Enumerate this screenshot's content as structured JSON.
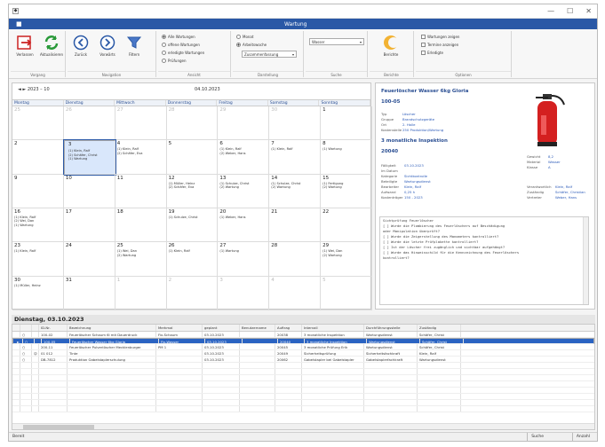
{
  "window": {
    "title": "Wartung",
    "file_tab": "■"
  },
  "ribbon": {
    "groups": [
      {
        "label": "Vorgang"
      },
      {
        "label": "Navigation"
      },
      {
        "label": "Ansicht"
      },
      {
        "label": "Darstellung"
      },
      {
        "label": "Suche"
      },
      {
        "label": "Berichte"
      },
      {
        "label": "Optionen"
      }
    ],
    "buttons": {
      "exit": "Verlassen",
      "refresh": "Aktualisieren",
      "back": "Zurück",
      "forward": "Vorwärts",
      "filter": "Filtern",
      "report": "Berichte"
    },
    "view_options": [
      "Alle Wartungen",
      "offene Wartungen",
      "erledigte Wartungen",
      "Prüfungen"
    ],
    "display_options": [
      "Monat",
      "Arbeitswoche"
    ],
    "display_select": "Zusammenfassung",
    "search_value": "Wasser",
    "option_checks": [
      "Wartungen zeigen",
      "Termine anzeigen",
      "Erledigte"
    ]
  },
  "calendar": {
    "nav": "◄ ► 2023 – 10",
    "current_date": "04.10.2023",
    "days": [
      "Montag",
      "Dienstag",
      "Mittwoch",
      "Donnerstag",
      "Freitag",
      "Samstag",
      "Sonntag"
    ],
    "weeks": [
      [
        {
          "d": "25",
          "out": true
        },
        {
          "d": "26",
          "out": true
        },
        {
          "d": "27",
          "out": true
        },
        {
          "d": "28",
          "out": true
        },
        {
          "d": "29",
          "out": true
        },
        {
          "d": "30",
          "out": true
        },
        {
          "d": "1"
        }
      ],
      [
        {
          "d": "2"
        },
        {
          "d": "3",
          "sel": true,
          "appts": [
            "(1) Klein, Ralf",
            "(2) Schäfer, Christ",
            "(1) Wartung"
          ]
        },
        {
          "d": "4",
          "appts": [
            "(1) Klein, Ralf",
            "(2) Schäfer, Eva"
          ]
        },
        {
          "d": "5"
        },
        {
          "d": "6",
          "appts": [
            "(1) Klein, Ralf",
            "(2) Weber, Hans"
          ]
        },
        {
          "d": "7",
          "appts": [
            "(1) Klein, Ralf"
          ]
        },
        {
          "d": "8",
          "appts": [
            "(1) Wartung"
          ]
        }
      ],
      [
        {
          "d": "9"
        },
        {
          "d": "10"
        },
        {
          "d": "11"
        },
        {
          "d": "12",
          "appts": [
            "(1) Müller, Heinz",
            "(2) Schäfer, Eva"
          ]
        },
        {
          "d": "13",
          "appts": [
            "(1) Schulze, Christ",
            "(2) Wartung"
          ]
        },
        {
          "d": "14",
          "appts": [
            "(1) Schulze, Christ",
            "(2) Wartung"
          ]
        },
        {
          "d": "15",
          "appts": [
            "(1) Fertigung",
            "(2) Wartung"
          ]
        }
      ],
      [
        {
          "d": "16",
          "appts": [
            "(1) Klein, Ralf",
            "(2) Wei, Dan",
            "(1) Wartung"
          ]
        },
        {
          "d": "17"
        },
        {
          "d": "18"
        },
        {
          "d": "19",
          "appts": [
            "(1) Schulze, Christ"
          ]
        },
        {
          "d": "20",
          "appts": [
            "(1) Weber, Hans"
          ]
        },
        {
          "d": "21"
        },
        {
          "d": "22"
        }
      ],
      [
        {
          "d": "23",
          "appts": [
            "(1) Klein, Ralf"
          ]
        },
        {
          "d": "24"
        },
        {
          "d": "25",
          "appts": [
            "(1) Wei, Dan",
            "(2) Wartung"
          ]
        },
        {
          "d": "26",
          "appts": [
            "(1) Klein, Ralf"
          ]
        },
        {
          "d": "27",
          "appts": [
            "(1) Wartung"
          ]
        },
        {
          "d": "28"
        },
        {
          "d": "29",
          "appts": [
            "(1) Wei, Dan",
            "(2) Wartung"
          ]
        }
      ],
      [
        {
          "d": "30",
          "appts": [
            "(1) Müller, Heinz"
          ]
        },
        {
          "d": "31"
        },
        {
          "d": "1",
          "out": true
        },
        {
          "d": "2",
          "out": true
        },
        {
          "d": "3",
          "out": true
        },
        {
          "d": "4",
          "out": true
        },
        {
          "d": "5",
          "out": true
        }
      ]
    ]
  },
  "detail": {
    "title": "Feuerlöscher Wasser 6kg Gloria",
    "number": "100-05",
    "info": [
      {
        "k": "Typ",
        "v": "Löscher"
      },
      {
        "k": "Gruppe",
        "v": "Brandschutzgeräte"
      },
      {
        "k": "Ort",
        "v": "2. Halle"
      },
      {
        "k": "Kostenstelle",
        "v": "250 Produktion/Wartung"
      }
    ],
    "interval_title": "3 monatliche Inspektion",
    "interval_number": "20040",
    "schedule": [
      {
        "k": "Fälligkeit",
        "v": "03.10.2023"
      },
      {
        "k": "Im Datum",
        "v": ""
      },
      {
        "k": "Kategorie",
        "v": "Sichtkontrolle"
      },
      {
        "k": "Beteiligte",
        "v": "Wartungsdienst"
      },
      {
        "k": "Bearbeiter",
        "v": "Klein, Ralf"
      },
      {
        "k": "Aufwand",
        "v": "0,25 h"
      },
      {
        "k": "Kostenträger",
        "v": "150 - 2023"
      }
    ],
    "specs": [
      {
        "k": "Gewicht",
        "v": "8,2"
      },
      {
        "k": "Material",
        "v": "Wasser"
      },
      {
        "k": "Klasse",
        "v": "A"
      }
    ],
    "people": [
      {
        "k": "Verantwortlich",
        "v": "Klein, Ralf"
      },
      {
        "k": "Zuständig",
        "v": "Schäfer, Christian"
      },
      {
        "k": "Vertreter",
        "v": "Weber, Hans"
      }
    ],
    "memo_lines": [
      "Sichtprüfung Feuerlöscher",
      "[ ] Wurde die Plombierung des Feuerlöschers auf Beschädigung",
      "    oder Manipulation überprüft?",
      "[ ] Wurde die Zeigerstellung des Manometers kontrolliert?",
      "[ ] Wurde die letzte Prüfplakette kontrolliert?",
      "[ ] Ist der Löscher frei zugänglich und sichtbar aufgehängt?",
      "[ ] Wurde das Hinweisschild für die Kennzeichnung des Feuerlöschers",
      "    kontrolliert?"
    ]
  },
  "day_header": "Dienstag, 03.10.2023",
  "table": {
    "columns": [
      "",
      "",
      "",
      "ID-Nr.",
      "Bezeichnung",
      "Merkmal",
      "geplant",
      "Benutzername",
      "Auftrag",
      "Intervall",
      "Durchführungsstelle",
      "Zuständig"
    ],
    "rows": [
      [
        "",
        "○",
        "",
        "100-02",
        "Feuerlöscher Schaum 6l mit Dauerdruck",
        "Fix-Schaum",
        "03.10.2023",
        "",
        "20038",
        "3 monatliche Inspektion",
        "Wartungsdienst",
        "Schäfer, Christ"
      ],
      [
        "►",
        "○",
        "",
        "100-05",
        "Feuerlöscher Wasser 6kg Gloria",
        "Fix-Wasser",
        "03.10.2023",
        "",
        "20040",
        "3 monatliche Inspektion",
        "Wartungsdienst",
        "Schäfer, Christ"
      ],
      [
        "",
        "○",
        "",
        "200-11",
        "Feuerlöscher Pulverlöscher Mecklenburger",
        "PM 1",
        "03.10.2023",
        "",
        "20045",
        "3 monatliche Prüfung Erik",
        "Wartungsdienst",
        "Schäfer, Christ"
      ],
      [
        "",
        "○",
        "☺",
        "01 012",
        "Tinte",
        "",
        "03.10.2023",
        "",
        "20049",
        "Sicherheitsprüfung",
        "Sicherheitsfachkraft",
        "Klein, Ralf"
      ],
      [
        "",
        "○",
        "",
        "DB-7812",
        "Produktion Gabelstaplerschulung",
        "",
        "03.10.2023",
        "",
        "20062",
        "Gabelstapler bei Gabelstapler",
        "Gabelstaplerfachkraft",
        "Wartungsdienst"
      ]
    ]
  },
  "status": {
    "left": "Bereit",
    "mid": "Suche",
    "right": "Anzahl"
  }
}
